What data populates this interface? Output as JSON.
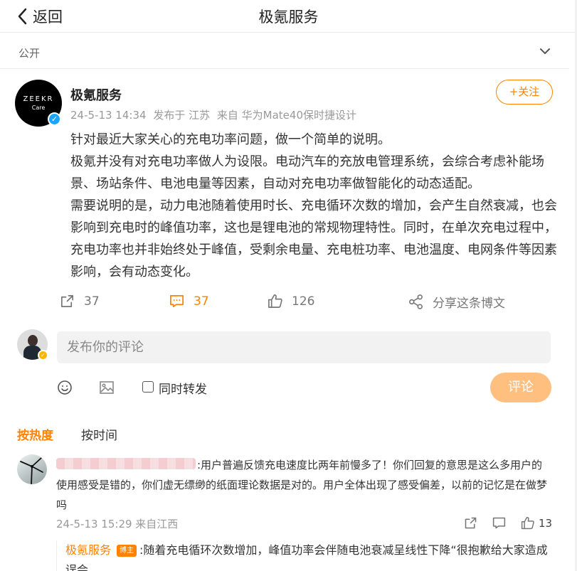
{
  "header": {
    "back_label": "返回",
    "title": "极氪服务"
  },
  "visibility": {
    "label": "公开"
  },
  "post": {
    "avatar_text": "ZEEKR",
    "avatar_subtext": "Care",
    "author": "极氪服务",
    "date": "24-5-13 14:34",
    "location": "发布于 江苏",
    "device": "来自 华为Mate40保时捷设计",
    "follow_label": "+关注",
    "paragraphs": [
      "针对最近大家关心的充电功率问题，做一个简单的说明。",
      "极氪并没有对充电功率做人为设限。电动汽车的充放电管理系统，会综合考虑补能场景、场站条件、电池电量等因素，自动对充电功率做智能化的动态适配。",
      "需要说明的是，动力电池随着使用时长、充电循环次数的增加，会产生自然衰减，也会影响到充电时的峰值功率，这也是锂电池的常规物理特性。同时，在单次充电过程中，充电功率也并非始终处于峰值，受剩余电量、充电桩功率、电池温度、电网条件等因素影响，会有动态变化。"
    ],
    "repost_count": "37",
    "comment_count": "37",
    "like_count": "126",
    "share_label": "分享这条博文"
  },
  "composer": {
    "placeholder": "发布你的评论",
    "repost_label": "同时转发",
    "submit_label": "评论"
  },
  "comments": {
    "sort_hot": "按热度",
    "sort_time": "按时间",
    "items": [
      {
        "text": ":用户普遍反馈充电速度比两年前慢多了！你们回复的意思是这么多用户的使用感受是错的，你们虚无缥缈的纸面理论数据是对的。用户全体出现了感受偏差，以前的记忆是在做梦吗",
        "meta": "24-5-13 15:29 来自江西",
        "like_count": "13",
        "reply": {
          "author": "极氪服务",
          "badge": "博主",
          "text": ":随着充电循环次数增加，峰值功率会伴随电池衰减呈线性下降“很抱歉给大家造成误会"
        }
      }
    ]
  },
  "colors": {
    "accent": "#ff8200",
    "muted": "#999999",
    "submit_disabled": "#ffbf7f",
    "verified": "#1ca5ff"
  }
}
